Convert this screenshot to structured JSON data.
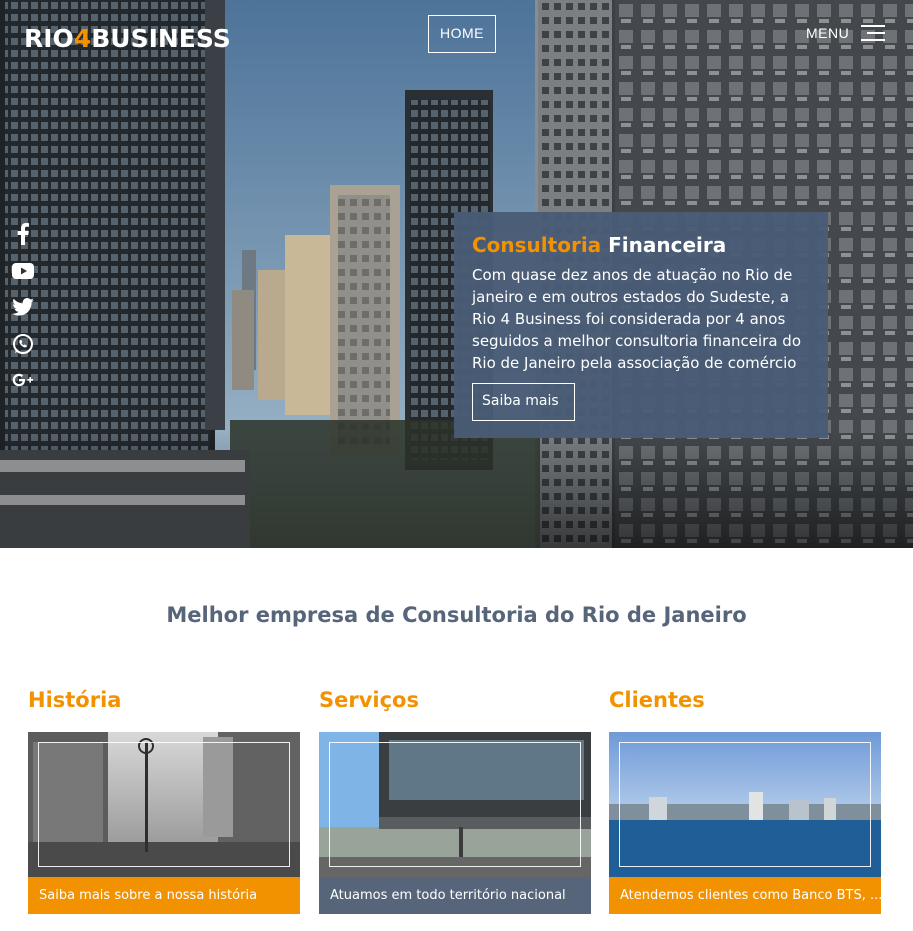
{
  "header": {
    "logo_part1": "RIO",
    "logo_part2": "4",
    "logo_part3": "BUSINESS",
    "home_label": "HOME",
    "menu_label": "MENU"
  },
  "social": [
    "facebook-icon",
    "youtube-icon",
    "twitter-icon",
    "whatsapp-icon",
    "google-plus-icon"
  ],
  "hero_card": {
    "title_highlight": "Consultoria",
    "title_rest": "Financeira",
    "body": "Com quase dez anos de atuação no Rio de janeiro e em outros estados do Sudeste, a Rio 4 Business foi considerada por 4 anos seguidos a melhor consultoria financeira do Rio de Janeiro pela associação de comércio",
    "button_label": "Saiba mais"
  },
  "section": {
    "headline": "Melhor empresa de Consultoria do Rio de Janeiro",
    "columns": [
      {
        "title": "História",
        "caption": "Saiba mais sobre a nossa história"
      },
      {
        "title": "Serviços",
        "caption": "Atuamos em todo território nacional"
      },
      {
        "title": "Clientes",
        "caption": "Atendemos clientes como Banco BTS, ..."
      }
    ]
  },
  "colors": {
    "accent": "#f39200",
    "slate": "#56657a",
    "card_bg": "#4a5c76"
  }
}
